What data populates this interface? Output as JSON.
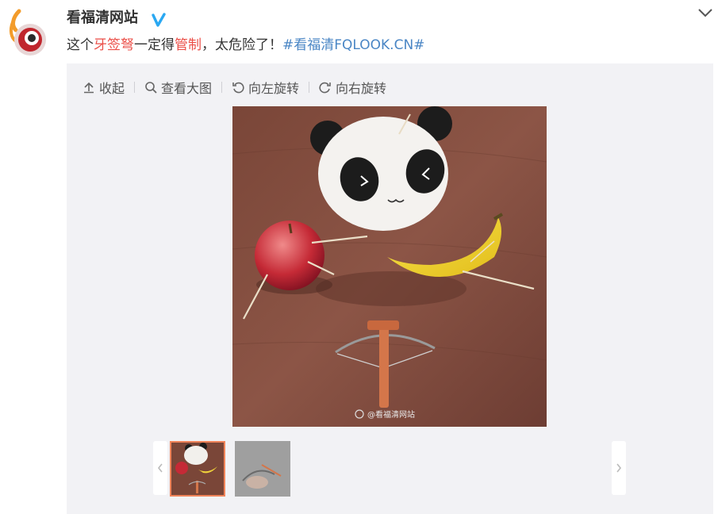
{
  "post": {
    "username": "看福清网站",
    "text_parts": {
      "p1": "这个",
      "k1": "牙签弩",
      "p2": "一定得",
      "k2": "管制",
      "p3": "，太危险了！",
      "topic": "#看福清FQLOOK.CN#"
    },
    "verified_icon": "verified-v-icon",
    "more_icon": "chevron-down-icon"
  },
  "toolbar": {
    "collapse": "收起",
    "view_large": "查看大图",
    "rotate_left": "向左旋转",
    "rotate_right": "向右旋转"
  },
  "photo": {
    "watermark": "@看福清网站"
  },
  "thumbnails": {
    "count": 2,
    "active_index": 0
  },
  "colors": {
    "keyword": "#eb4f48",
    "topic_link": "#4a86c5",
    "media_bg": "#f2f2f5",
    "active_thumb_border": "#f0845a"
  }
}
